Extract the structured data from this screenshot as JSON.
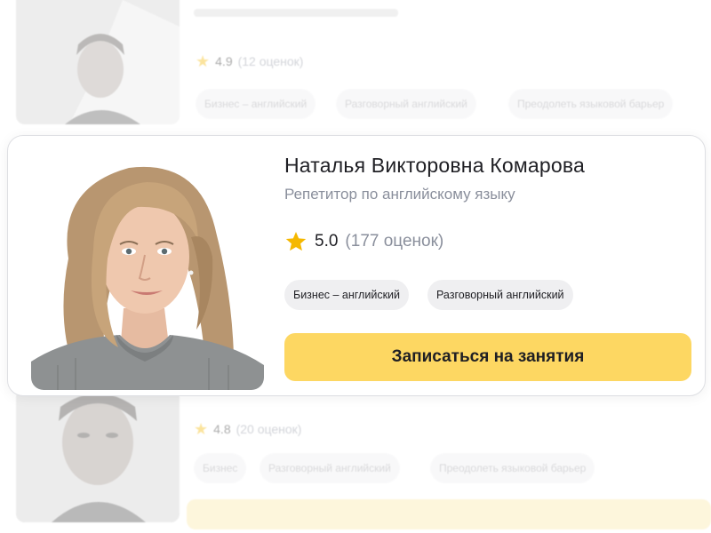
{
  "background_cards": {
    "top": {
      "rating_value": "4.9",
      "rating_count": "(12 оценок)",
      "tags": [
        "Бизнес – английский",
        "Разговорный английский",
        "Преодолеть языковой барьер"
      ]
    },
    "bottom": {
      "rating_value": "4.8",
      "rating_count": "(20 оценок)",
      "tags": [
        "Бизнес",
        "Разговорный английский",
        "Преодолеть языковой барьер"
      ]
    }
  },
  "card": {
    "name": "Наталья Викторовна Комарова",
    "subtitle": "Репетитор по английскому языку",
    "rating_value": "5.0",
    "rating_count": "(177 оценок)",
    "tags": [
      "Бизнес – английский",
      "Разговорный английский"
    ],
    "cta_label": "Записаться на занятия",
    "icons": {
      "rating": "star-icon"
    }
  },
  "colors": {
    "accent": "#fdd762",
    "star": "#f5b800",
    "muted_text": "#8a8f9c",
    "chip_bg": "#efeff1"
  }
}
